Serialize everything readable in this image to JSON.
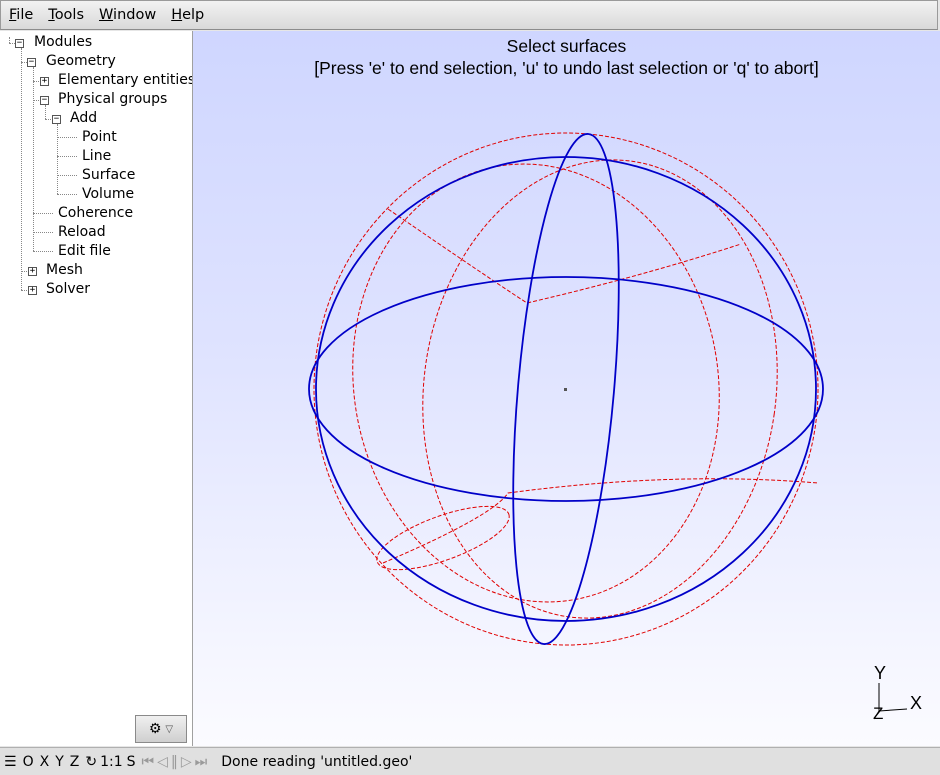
{
  "menu": [
    {
      "u": "F",
      "rest": "ile"
    },
    {
      "u": "T",
      "rest": "ools"
    },
    {
      "u": "W",
      "rest": "indow"
    },
    {
      "u": "H",
      "rest": "elp"
    }
  ],
  "tree": {
    "modules": "Modules",
    "geometry": "Geometry",
    "elementary": "Elementary entities",
    "physical": "Physical groups",
    "add": "Add",
    "point": "Point",
    "line": "Line",
    "surface": "Surface",
    "volume": "Volume",
    "coherence": "Coherence",
    "reload": "Reload",
    "edit_file": "Edit file",
    "mesh": "Mesh",
    "solver": "Solver"
  },
  "graphics": {
    "title_line1": "Select surfaces",
    "title_line2": "[Press 'e' to end selection, 'u' to undo last selection or 'q' to abort]",
    "axis_y": "Y",
    "axis_x": "X",
    "axis_z": "Z",
    "colors": {
      "selected": "#0000c8",
      "dashed": "#e00000"
    }
  },
  "status": {
    "menu_icon": "☰",
    "o": "O",
    "x": "X",
    "y": "Y",
    "z": "Z",
    "rotate_icon": "↻",
    "scale": "1:1",
    "s": "S",
    "nav_first": "⏮",
    "nav_prev": "◁",
    "nav_pause": "‖",
    "nav_play": "▷",
    "nav_last": "⏭",
    "message": "Done reading 'untitled.geo'"
  },
  "icons": {
    "gear": "⚙",
    "dropdown": "▽"
  }
}
